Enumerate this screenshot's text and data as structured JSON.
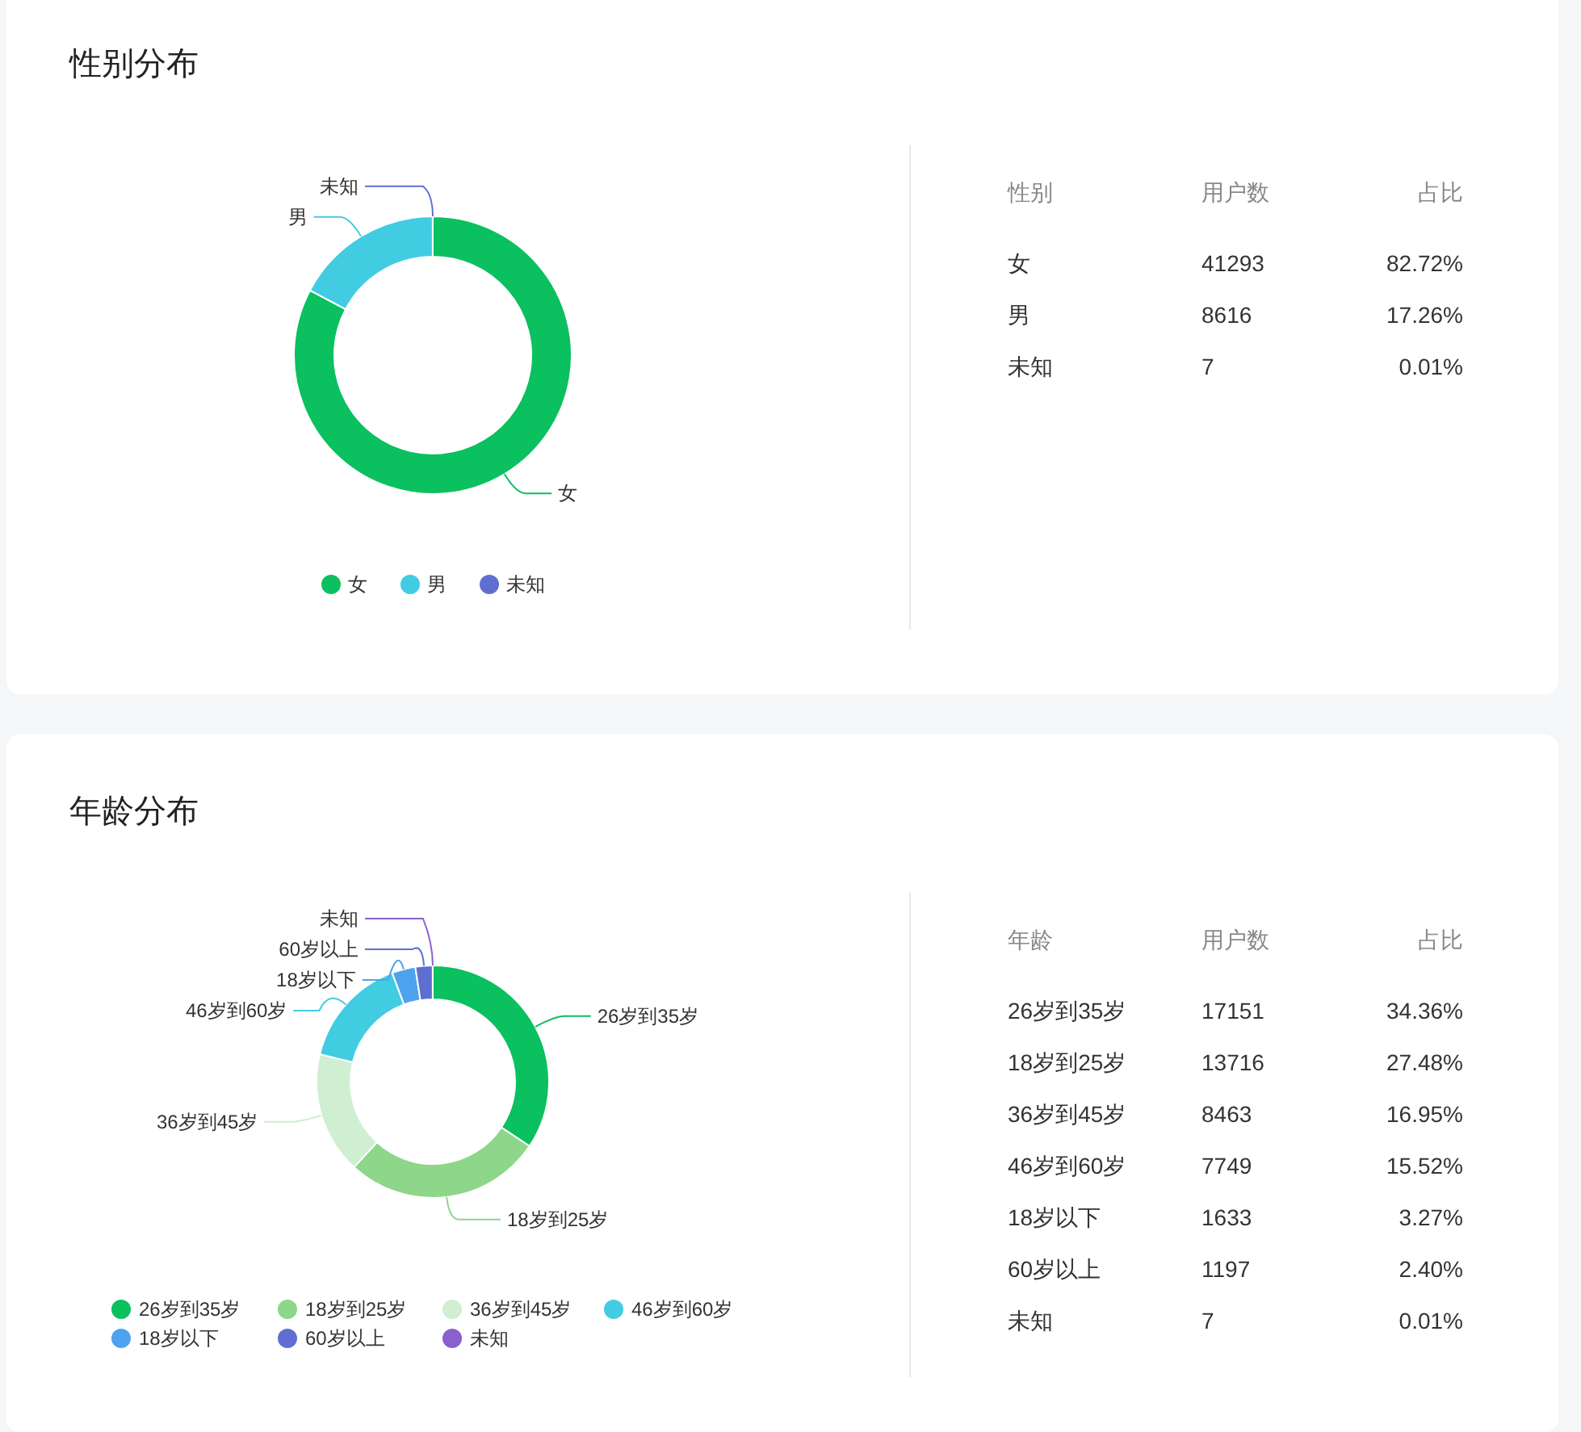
{
  "sections": [
    {
      "title": "性别分布",
      "chart": {
        "chart_data": {
          "type": "donut",
          "categories": [
            "女",
            "男",
            "未知"
          ],
          "values": [
            82.72,
            17.26,
            0.01
          ]
        },
        "legend": [
          {
            "label": "女",
            "color": "#0ac05f"
          },
          {
            "label": "男",
            "color": "#41cce2"
          },
          {
            "label": "未知",
            "color": "#5f6fd1"
          }
        ]
      },
      "table": {
        "columns": [
          "性别",
          "用户数",
          "占比"
        ],
        "rows": [
          [
            "女",
            "41293",
            "82.72%"
          ],
          [
            "男",
            "8616",
            "17.26%"
          ],
          [
            "未知",
            "7",
            "0.01%"
          ]
        ]
      }
    },
    {
      "title": "年龄分布",
      "chart": {
        "chart_data": {
          "type": "donut",
          "categories": [
            "26岁到35岁",
            "18岁到25岁",
            "36岁到45岁",
            "46岁到60岁",
            "18岁以下",
            "60岁以上",
            "未知"
          ],
          "values": [
            34.36,
            27.48,
            16.95,
            15.52,
            3.27,
            2.4,
            0.01
          ]
        },
        "legend": [
          {
            "label": "26岁到35岁",
            "color": "#0ac05f"
          },
          {
            "label": "18岁到25岁",
            "color": "#8dd68a"
          },
          {
            "label": "36岁到45岁",
            "color": "#cfeed2"
          },
          {
            "label": "46岁到60岁",
            "color": "#41cce2"
          },
          {
            "label": "18岁以下",
            "color": "#4ea3ee"
          },
          {
            "label": "60岁以上",
            "color": "#5f6fd1"
          },
          {
            "label": "未知",
            "color": "#8a5fcf"
          }
        ]
      },
      "table": {
        "columns": [
          "年龄",
          "用户数",
          "占比"
        ],
        "rows": [
          [
            "26岁到35岁",
            "17151",
            "34.36%"
          ],
          [
            "18岁到25岁",
            "13716",
            "27.48%"
          ],
          [
            "36岁到45岁",
            "8463",
            "16.95%"
          ],
          [
            "46岁到60岁",
            "7749",
            "15.52%"
          ],
          [
            "18岁以下",
            "1633",
            "3.27%"
          ],
          [
            "60岁以上",
            "1197",
            "2.40%"
          ],
          [
            "未知",
            "7",
            "0.01%"
          ]
        ]
      }
    }
  ]
}
